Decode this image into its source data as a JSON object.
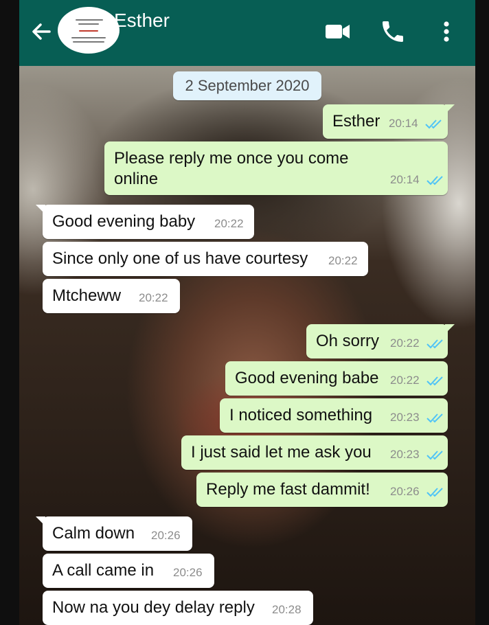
{
  "header": {
    "contact_name": "Esther",
    "color": "#075e54"
  },
  "chat": {
    "date_chip": "2 September 2020",
    "messages": [
      {
        "dir": "out",
        "text": "Esther",
        "time": "20:14",
        "read": true
      },
      {
        "dir": "out",
        "text": "Please reply me once you come online",
        "time": "20:14",
        "read": true
      },
      {
        "dir": "in",
        "text": "Good evening baby",
        "time": "20:22"
      },
      {
        "dir": "in",
        "text": "Since only one of us have courtesy",
        "time": "20:22"
      },
      {
        "dir": "in",
        "text": "Mtcheww",
        "time": "20:22"
      },
      {
        "dir": "out",
        "text": "Oh sorry",
        "time": "20:22",
        "read": true
      },
      {
        "dir": "out",
        "text": "Good evening babe",
        "time": "20:22",
        "read": true
      },
      {
        "dir": "out",
        "text": "I noticed something",
        "time": "20:23",
        "read": true
      },
      {
        "dir": "out",
        "text": "I just said let me ask you",
        "time": "20:23",
        "read": true
      },
      {
        "dir": "out",
        "text": "Reply me fast dammit!",
        "time": "20:26",
        "read": true
      },
      {
        "dir": "in",
        "text": "Calm down",
        "time": "20:26"
      },
      {
        "dir": "in",
        "text": "A call came in",
        "time": "20:26"
      },
      {
        "dir": "in",
        "text": "Now na you dey delay reply",
        "time": "20:28"
      }
    ],
    "colors": {
      "outgoing_bubble": "#dcf8c6",
      "incoming_bubble": "#ffffff",
      "read_ticks": "#4fc3f7"
    }
  }
}
